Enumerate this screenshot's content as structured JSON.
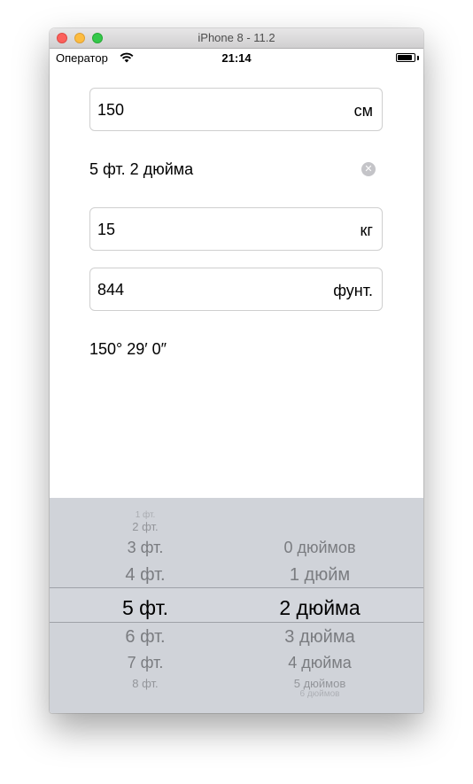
{
  "window": {
    "title": "iPhone 8 - 11.2"
  },
  "status_bar": {
    "carrier": "Оператор",
    "time": "21:14",
    "battery_level": 0.9
  },
  "form": {
    "height_cm": {
      "value": "150",
      "unit": "см"
    },
    "height_ft": {
      "text": "5 фт. 2 дюйма"
    },
    "weight_kg": {
      "value": "15",
      "unit": "кг"
    },
    "weight_lb": {
      "value": "844",
      "unit": "фунт."
    },
    "angle": {
      "text": "150° 29′ 0″"
    }
  },
  "picker": {
    "feet": [
      "1 фт.",
      "2 фт.",
      "3 фт.",
      "4 фт.",
      "5 фт.",
      "6 фт.",
      "7 фт.",
      "8 фт."
    ],
    "inches": [
      "0 дюймов",
      "1 дюйм",
      "2 дюйма",
      "3 дюйма",
      "4 дюйма",
      "5 дюймов",
      "6 дюймов"
    ],
    "selected_feet": "5 фт.",
    "selected_inches": "2 дюйма"
  },
  "colors": {
    "picker_bg": "#d0d3d9",
    "close": "#fc605c",
    "minimize": "#fdbc40",
    "maximize": "#34c84a"
  }
}
